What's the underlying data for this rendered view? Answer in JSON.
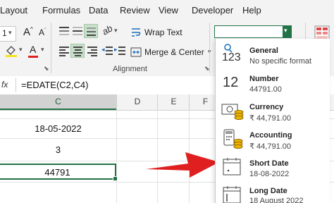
{
  "menu": {
    "items": [
      "Layout",
      "Formulas",
      "Data",
      "Review",
      "View",
      "Developer",
      "Help"
    ]
  },
  "ribbon": {
    "font_size_partial": "1",
    "wrap_text": "Wrap Text",
    "merge_center": "Merge & Center",
    "group_alignment": "Alignment",
    "font_grow": "A",
    "font_shrink": "A",
    "font_color": "A"
  },
  "formula_bar": {
    "fx": "fx",
    "formula": "=EDATE(C2,C4)"
  },
  "grid": {
    "columns": [
      "C",
      "D",
      "E",
      "F"
    ],
    "cells": {
      "c2": "18-05-2022",
      "c4": "3",
      "c6": "44791"
    }
  },
  "number_format": {
    "current_value": "",
    "options": [
      {
        "name": "General",
        "sample": "No specific format",
        "icon": "general-123-icon",
        "icon_text": "123"
      },
      {
        "name": "Number",
        "sample": "44791.00",
        "icon": "number-12-icon",
        "icon_text": "12"
      },
      {
        "name": "Currency",
        "sample": "₹ 44,791.00",
        "icon": "currency-icon"
      },
      {
        "name": "Accounting",
        "sample": "₹ 44,791.00",
        "icon": "accounting-icon"
      },
      {
        "name": "Short Date",
        "sample": "18-08-2022",
        "icon": "short-date-calendar-icon"
      },
      {
        "name": "Long Date",
        "sample": "18 August 2022",
        "icon": "long-date-calendar-icon"
      }
    ]
  },
  "colors": {
    "accent_green": "#217346",
    "arrow_red": "#e02020",
    "selection_green": "#c6e0c9"
  }
}
